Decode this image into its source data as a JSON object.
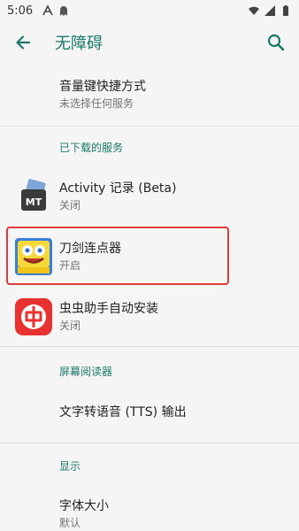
{
  "status_bar": {
    "time": "5:06",
    "notification_icons": [
      "a-icon",
      "ghost-icon"
    ],
    "system_icons": [
      "wifi-icon",
      "signal-icon",
      "battery-icon"
    ]
  },
  "app_bar": {
    "title": "无障碍",
    "back_icon": "arrow-back-icon",
    "search_icon": "search-icon"
  },
  "top_item": {
    "title": "音量键快捷方式",
    "subtitle": "未选择任何服务"
  },
  "downloaded_section": {
    "header": "已下载的服务",
    "items": [
      {
        "title": "Activity 记录 (Beta)",
        "subtitle": "关闭",
        "icon": "mt-app-icon"
      },
      {
        "title": "刀剑连点器",
        "subtitle": "开启",
        "icon": "spongebob-app-icon"
      },
      {
        "title": "虫虫助手自动安装",
        "subtitle": "关闭",
        "icon": "chongchong-app-icon"
      }
    ]
  },
  "screen_reader_section": {
    "header": "屏幕阅读器",
    "items": [
      {
        "title": "文字转语音 (TTS) 输出"
      }
    ]
  },
  "display_section": {
    "header": "显示",
    "items": [
      {
        "title": "字体大小",
        "subtitle": "默认"
      }
    ]
  },
  "colors": {
    "accent": "#1a7a6a",
    "highlight_border": "#e03b3b"
  }
}
